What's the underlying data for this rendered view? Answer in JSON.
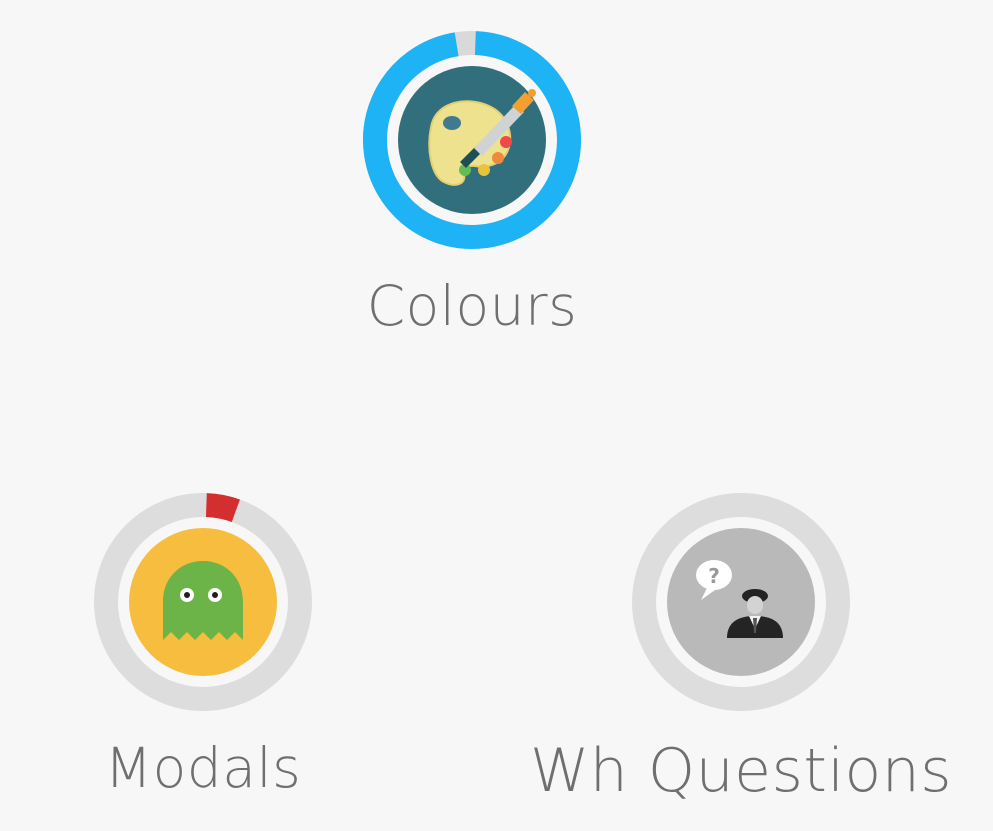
{
  "lessons": [
    {
      "id": "colours",
      "label": "Colours",
      "icon": "paint-palette-icon",
      "progress": 0.98,
      "ring_color": "#1db3f5",
      "track_color": "#d9d9d9",
      "inner_color": "#316f7c"
    },
    {
      "id": "modals",
      "label": "Modals",
      "icon": "green-ghost-icon",
      "progress": 0.05,
      "ring_color": "#d32f2f",
      "track_color": "#dddddd",
      "inner_color": "#f6bd3f"
    },
    {
      "id": "wh-questions",
      "label": "Wh Questions",
      "icon": "question-person-icon",
      "progress": 0,
      "ring_color": "#bdbdbd",
      "track_color": "#dddddd",
      "inner_color": "#b9b9b9"
    }
  ],
  "icons": {
    "question_mark": "?"
  }
}
